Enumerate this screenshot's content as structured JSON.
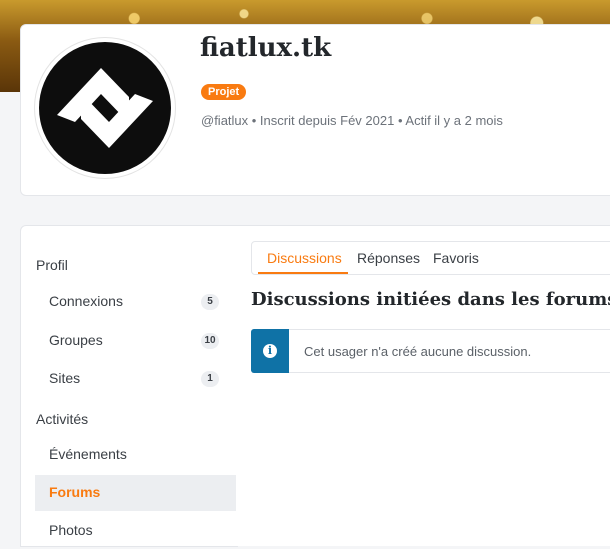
{
  "profile": {
    "title": "fiatlux.tk",
    "badge": "Projet",
    "meta": "@fiatlux • Inscrit depuis Fév 2021 • Actif il y a 2 mois"
  },
  "sidebar": {
    "section_profile": "Profil",
    "items_profile": [
      {
        "label": "Connexions",
        "count": "5"
      },
      {
        "label": "Groupes",
        "count": "10"
      },
      {
        "label": "Sites",
        "count": "1"
      }
    ],
    "section_activities": "Activités",
    "items_activities": [
      {
        "label": "Événements"
      },
      {
        "label": "Forums"
      },
      {
        "label": "Photos"
      }
    ]
  },
  "main": {
    "tabs": [
      {
        "label": "Discussions"
      },
      {
        "label": "Réponses"
      },
      {
        "label": "Favoris"
      }
    ],
    "section_title": "Discussions initiées dans les forums",
    "notice": "Cet usager n'a créé aucune discussion."
  },
  "colors": {
    "accent": "#f97b11",
    "info": "#0f72a6"
  },
  "icons": {
    "avatar": "fiatlux-logo",
    "notice": "info-icon"
  }
}
